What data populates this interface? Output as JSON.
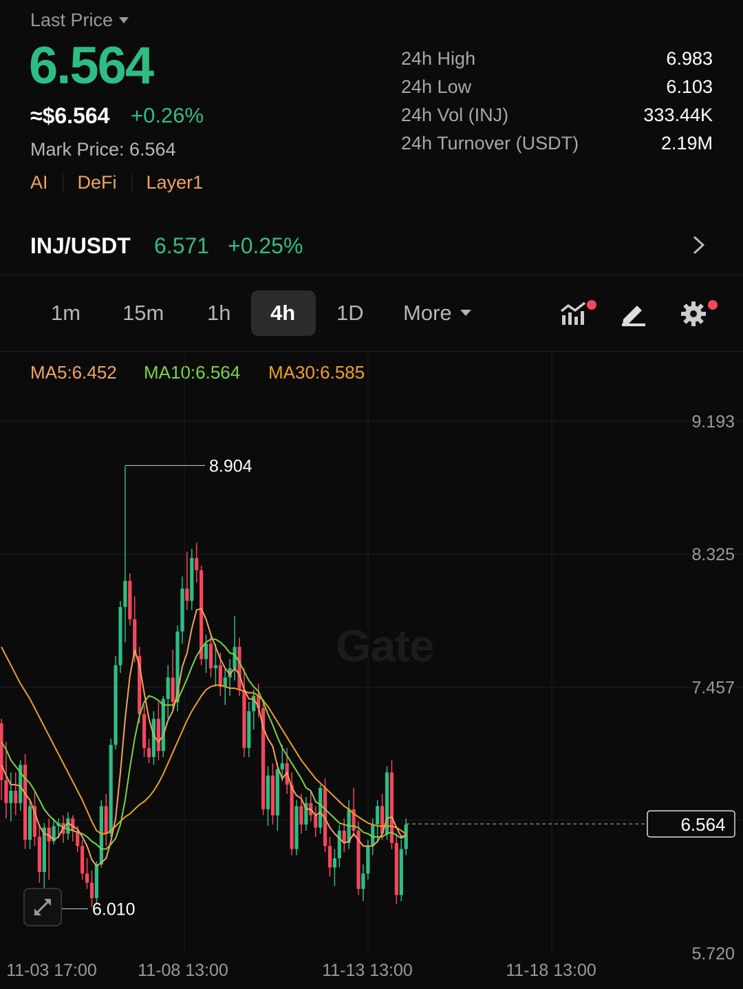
{
  "header": {
    "last_price_label": "Last Price",
    "last_price": "6.564",
    "usd_price": "≈$6.564",
    "change_pct": "+0.26%",
    "mark_price": "Mark Price:  6.564",
    "tags": [
      "AI",
      "DeFi",
      "Layer1"
    ]
  },
  "stats": [
    {
      "label": "24h High",
      "value": "6.983"
    },
    {
      "label": "24h Low",
      "value": "6.103"
    },
    {
      "label": "24h Vol (INJ)",
      "value": "333.44K"
    },
    {
      "label": "24h Turnover (USDT)",
      "value": "2.19M"
    }
  ],
  "pair": {
    "name": "INJ/USDT",
    "price": "6.571",
    "change": "+0.25%"
  },
  "timeframes": [
    "1m",
    "15m",
    "1h",
    "4h",
    "1D"
  ],
  "active_timeframe": "4h",
  "more_label": "More",
  "toolbar_icons": [
    "indicators-icon",
    "draw-icon",
    "settings-icon"
  ],
  "ma": {
    "ma5": "MA5:6.452",
    "ma10": "MA10:6.564",
    "ma30": "MA30:6.585"
  },
  "colors": {
    "up": "#2ebd85",
    "down": "#f6465d",
    "ma5": "#f2a35e",
    "ma10": "#7cd444",
    "ma30": "#f0a020"
  },
  "watermark": "Gate",
  "chart_data": {
    "type": "candlestick",
    "ylim": [
      5.72,
      9.193
    ],
    "y_ticks": [
      "9.193",
      "8.325",
      "7.457",
      "5.720"
    ],
    "x_ticks": [
      "11-03 17:00",
      "11-08 13:00",
      "11-13 13:00",
      "11-18 13:00"
    ],
    "high_marker": "8.904",
    "low_marker": "6.010",
    "last_price_tag": "6.564",
    "candles": [
      [
        7.22,
        7.25,
        6.72,
        6.85
      ],
      [
        6.85,
        7.1,
        6.6,
        6.7
      ],
      [
        6.7,
        6.9,
        6.58,
        6.78
      ],
      [
        6.78,
        6.9,
        6.62,
        6.7
      ],
      [
        6.7,
        6.98,
        6.65,
        6.95
      ],
      [
        6.95,
        7.02,
        6.4,
        6.46
      ],
      [
        6.46,
        6.72,
        6.4,
        6.68
      ],
      [
        6.68,
        6.78,
        6.42,
        6.48
      ],
      [
        6.48,
        6.56,
        6.18,
        6.25
      ],
      [
        6.25,
        6.57,
        6.02,
        6.54
      ],
      [
        6.54,
        6.6,
        6.2,
        6.45
      ],
      [
        6.45,
        6.6,
        6.43,
        6.55
      ],
      [
        6.55,
        6.6,
        6.47,
        6.57
      ],
      [
        6.57,
        6.62,
        6.44,
        6.5
      ],
      [
        6.5,
        6.64,
        6.46,
        6.6
      ],
      [
        6.6,
        6.62,
        6.45,
        6.52
      ],
      [
        6.52,
        6.55,
        6.38,
        6.42
      ],
      [
        6.42,
        6.46,
        6.2,
        6.24
      ],
      [
        6.24,
        6.34,
        6.14,
        6.18
      ],
      [
        6.18,
        6.26,
        6.02,
        6.08
      ],
      [
        6.08,
        6.32,
        6.04,
        6.3
      ],
      [
        6.3,
        6.72,
        6.28,
        6.68
      ],
      [
        6.68,
        6.76,
        6.42,
        6.5
      ],
      [
        6.5,
        7.12,
        6.48,
        7.08
      ],
      [
        7.08,
        7.66,
        7.05,
        7.6
      ],
      [
        7.6,
        8.02,
        7.55,
        7.98
      ],
      [
        7.98,
        8.9,
        7.75,
        8.15
      ],
      [
        8.15,
        8.2,
        7.86,
        7.9
      ],
      [
        7.9,
        8.05,
        7.62,
        7.66
      ],
      [
        7.66,
        7.72,
        7.22,
        7.28
      ],
      [
        7.28,
        7.34,
        7.0,
        7.06
      ],
      [
        7.06,
        7.12,
        6.96,
        7.0
      ],
      [
        7.0,
        7.3,
        6.95,
        7.25
      ],
      [
        7.25,
        7.36,
        6.98,
        7.04
      ],
      [
        7.04,
        7.4,
        7.0,
        7.38
      ],
      [
        7.38,
        7.6,
        7.25,
        7.52
      ],
      [
        7.52,
        7.7,
        7.3,
        7.36
      ],
      [
        7.36,
        7.86,
        7.3,
        7.82
      ],
      [
        7.82,
        8.18,
        7.74,
        8.1
      ],
      [
        8.1,
        8.34,
        7.96,
        8.02
      ],
      [
        8.02,
        8.36,
        7.96,
        8.3
      ],
      [
        8.3,
        8.4,
        8.14,
        8.22
      ],
      [
        8.22,
        8.25,
        7.6,
        7.64
      ],
      [
        7.64,
        7.8,
        7.55,
        7.74
      ],
      [
        7.74,
        7.8,
        7.52,
        7.58
      ],
      [
        7.58,
        7.74,
        7.46,
        7.6
      ],
      [
        7.6,
        7.68,
        7.4,
        7.46
      ],
      [
        7.46,
        7.58,
        7.34,
        7.52
      ],
      [
        7.52,
        7.64,
        7.4,
        7.58
      ],
      [
        7.58,
        7.92,
        7.5,
        7.72
      ],
      [
        7.72,
        7.78,
        7.4,
        7.44
      ],
      [
        7.44,
        7.58,
        7.0,
        7.06
      ],
      [
        7.06,
        7.36,
        7.0,
        7.3
      ],
      [
        7.3,
        7.44,
        7.18,
        7.4
      ],
      [
        7.4,
        7.48,
        7.26,
        7.32
      ],
      [
        7.32,
        7.38,
        6.62,
        6.66
      ],
      [
        6.66,
        6.94,
        6.55,
        6.88
      ],
      [
        6.88,
        6.96,
        6.56,
        6.62
      ],
      [
        6.62,
        6.96,
        6.52,
        6.92
      ],
      [
        6.92,
        7.08,
        6.84,
        6.96
      ],
      [
        6.96,
        7.06,
        6.76,
        6.82
      ],
      [
        6.82,
        6.9,
        6.36,
        6.4
      ],
      [
        6.4,
        6.72,
        6.36,
        6.68
      ],
      [
        6.68,
        6.76,
        6.5,
        6.56
      ],
      [
        6.56,
        6.74,
        6.52,
        6.7
      ],
      [
        6.7,
        6.78,
        6.58,
        6.62
      ],
      [
        6.62,
        6.68,
        6.48,
        6.54
      ],
      [
        6.54,
        6.82,
        6.5,
        6.8
      ],
      [
        6.8,
        6.86,
        6.38,
        6.42
      ],
      [
        6.42,
        6.48,
        6.22,
        6.28
      ],
      [
        6.28,
        6.4,
        6.16,
        6.34
      ],
      [
        6.34,
        6.56,
        6.28,
        6.52
      ],
      [
        6.52,
        6.6,
        6.38,
        6.44
      ],
      [
        6.44,
        6.72,
        6.4,
        6.66
      ],
      [
        6.66,
        6.8,
        6.48,
        6.52
      ],
      [
        6.52,
        6.58,
        6.1,
        6.14
      ],
      [
        6.14,
        6.3,
        6.06,
        6.24
      ],
      [
        6.24,
        6.46,
        6.2,
        6.42
      ],
      [
        6.42,
        6.6,
        6.36,
        6.56
      ],
      [
        6.56,
        6.72,
        6.44,
        6.68
      ],
      [
        6.68,
        6.76,
        6.46,
        6.5
      ],
      [
        6.5,
        6.94,
        6.46,
        6.9
      ],
      [
        6.9,
        6.98,
        6.4,
        6.44
      ],
      [
        6.44,
        6.5,
        6.04,
        6.1
      ],
      [
        6.1,
        6.46,
        6.06,
        6.4
      ],
      [
        6.4,
        6.6,
        6.36,
        6.56
      ]
    ],
    "ma5": [
      6.95,
      6.88,
      6.82,
      6.82,
      6.81,
      6.76,
      6.72,
      6.64,
      6.55,
      6.5,
      6.49,
      6.46,
      6.48,
      6.54,
      6.57,
      6.55,
      6.53,
      6.48,
      6.42,
      6.33,
      6.29,
      6.31,
      6.34,
      6.45,
      6.6,
      6.9,
      7.25,
      7.53,
      7.7,
      7.6,
      7.42,
      7.25,
      7.14,
      7.1,
      7.14,
      7.24,
      7.3,
      7.42,
      7.59,
      7.68,
      7.84,
      7.96,
      7.97,
      7.9,
      7.8,
      7.72,
      7.64,
      7.58,
      7.54,
      7.58,
      7.54,
      7.44,
      7.38,
      7.38,
      7.33,
      7.19,
      7.12,
      7.07,
      6.94,
      6.86,
      6.9,
      6.8,
      6.75,
      6.73,
      6.66,
      6.66,
      6.62,
      6.64,
      6.6,
      6.54,
      6.5,
      6.47,
      6.44,
      6.45,
      6.5,
      6.46,
      6.42,
      6.42,
      6.42,
      6.45,
      6.5,
      6.6,
      6.61,
      6.54,
      6.48,
      6.49
    ],
    "ma10": [
      7.1,
      7.05,
      6.98,
      6.94,
      6.9,
      6.86,
      6.83,
      6.78,
      6.72,
      6.66,
      6.62,
      6.59,
      6.56,
      6.54,
      6.53,
      6.52,
      6.51,
      6.5,
      6.48,
      6.45,
      6.43,
      6.4,
      6.4,
      6.43,
      6.47,
      6.56,
      6.72,
      6.93,
      7.12,
      7.27,
      7.36,
      7.4,
      7.39,
      7.37,
      7.34,
      7.34,
      7.34,
      7.37,
      7.44,
      7.51,
      7.59,
      7.66,
      7.71,
      7.75,
      7.77,
      7.77,
      7.75,
      7.72,
      7.68,
      7.67,
      7.62,
      7.56,
      7.5,
      7.46,
      7.43,
      7.36,
      7.28,
      7.21,
      7.13,
      7.06,
      7.01,
      6.96,
      6.91,
      6.86,
      6.8,
      6.78,
      6.71,
      6.69,
      6.66,
      6.63,
      6.6,
      6.57,
      6.56,
      6.55,
      6.55,
      6.54,
      6.51,
      6.5,
      6.48,
      6.48,
      6.48,
      6.5,
      6.51,
      6.49,
      6.47,
      6.49
    ],
    "ma30": [
      7.72,
      7.66,
      7.6,
      7.54,
      7.48,
      7.43,
      7.38,
      7.32,
      7.26,
      7.2,
      7.14,
      7.08,
      7.02,
      6.96,
      6.9,
      6.84,
      6.78,
      6.72,
      6.65,
      6.58,
      6.52,
      6.5,
      6.5,
      6.52,
      6.55,
      6.58,
      6.61,
      6.63,
      6.66,
      6.69,
      6.71,
      6.74,
      6.78,
      6.83,
      6.89,
      6.96,
      7.03,
      7.1,
      7.17,
      7.24,
      7.3,
      7.35,
      7.4,
      7.44,
      7.46,
      7.47,
      7.47,
      7.46,
      7.45,
      7.45,
      7.44,
      7.43,
      7.42,
      7.42,
      7.4,
      7.37,
      7.33,
      7.28,
      7.23,
      7.18,
      7.13,
      7.08,
      7.03,
      6.98,
      6.94,
      6.9,
      6.86,
      6.83,
      6.8,
      6.77,
      6.74,
      6.71,
      6.68,
      6.66,
      6.63,
      6.61,
      6.59,
      6.57,
      6.56,
      6.55,
      6.55,
      6.55,
      6.55,
      6.54,
      6.52,
      6.5
    ]
  }
}
